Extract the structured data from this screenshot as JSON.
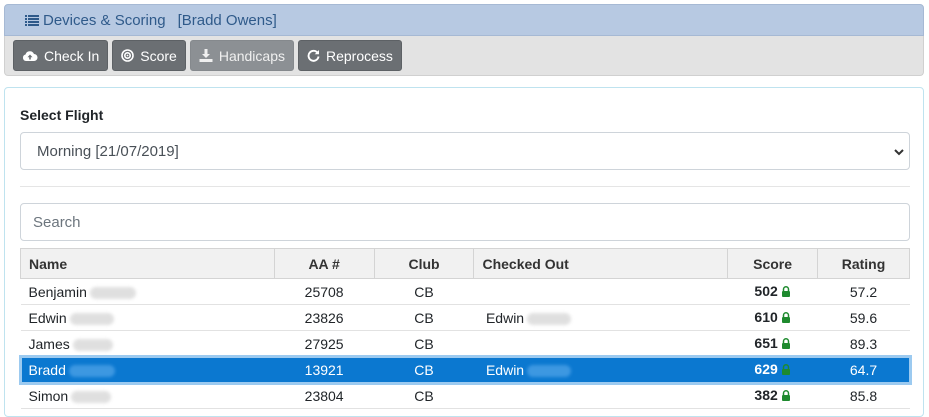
{
  "header": {
    "title": "Devices & Scoring",
    "owner": "[Bradd Owens]"
  },
  "toolbar": {
    "check_in": "Check In",
    "score": "Score",
    "handicaps": "Handicaps",
    "reprocess": "Reprocess"
  },
  "flight": {
    "label": "Select Flight",
    "selected": "Morning [21/07/2019]"
  },
  "search": {
    "placeholder": "Search"
  },
  "table": {
    "headers": {
      "name": "Name",
      "aa": "AA #",
      "club": "Club",
      "checked_out": "Checked Out",
      "score": "Score",
      "rating": "Rating"
    },
    "rows": [
      {
        "first": "Benjamin",
        "aa": "25708",
        "club": "CB",
        "out": "",
        "score": "502",
        "rating": "57.2"
      },
      {
        "first": "Edwin",
        "aa": "23826",
        "club": "CB",
        "out": "Edwin",
        "score": "610",
        "rating": "59.6"
      },
      {
        "first": "James",
        "aa": "27925",
        "club": "CB",
        "out": "",
        "score": "651",
        "rating": "89.3"
      },
      {
        "first": "Bradd",
        "aa": "13921",
        "club": "CB",
        "out": "Edwin",
        "score": "629",
        "rating": "64.7"
      },
      {
        "first": "Simon",
        "aa": "23804",
        "club": "CB",
        "out": "",
        "score": "382",
        "rating": "85.8"
      }
    ]
  },
  "colors": {
    "selected_row": "#0b78d0",
    "lock": "#1e8a2e",
    "header_bar": "#b7c9e2"
  }
}
